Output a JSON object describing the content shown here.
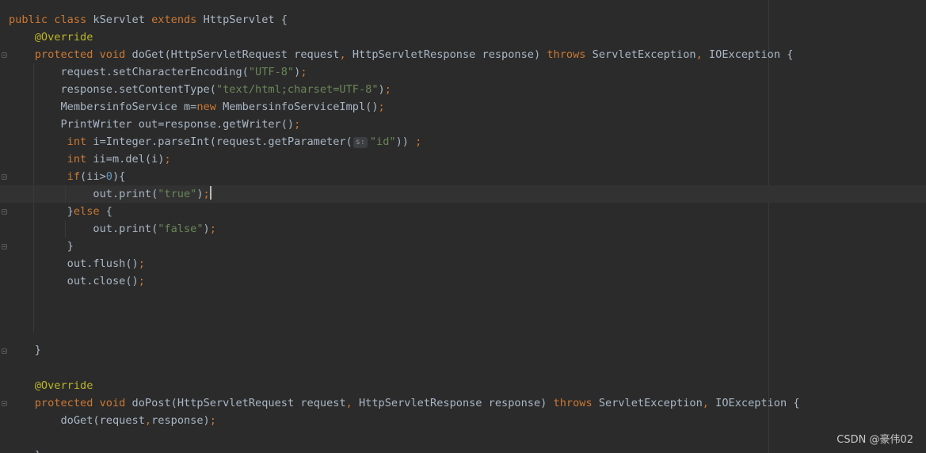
{
  "colors": {
    "background": "#2b2b2b",
    "keyword": "#cc7832",
    "annotation": "#bbb529",
    "string": "#6a8759",
    "number": "#6897bb",
    "plain": "#a9b7c6"
  },
  "code": {
    "l1": {
      "a": "public",
      "b": "class",
      "c": "kServlet",
      "d": "extends",
      "e": "HttpServlet {"
    },
    "l2": {
      "a": "@Override"
    },
    "l3": {
      "a": "protected",
      "b": "void",
      "c": "doGet(HttpServletRequest request",
      "d": ",",
      "e": " HttpServletResponse response) ",
      "f": "throws",
      "g": " ServletException",
      "h": ",",
      "i": " IOException {"
    },
    "l4": {
      "a": "request.setCharacterEncoding(",
      "b": "\"UTF-8\"",
      "c": ")",
      "d": ";"
    },
    "l5": {
      "a": "response.setContentType(",
      "b": "\"text/html;charset=UTF-8\"",
      "c": ")",
      "d": ";"
    },
    "l6": {
      "a": "MembersinfoService m=",
      "b": "new",
      "c": " MembersinfoServiceImpl()",
      "d": ";"
    },
    "l7": {
      "a": "PrintWriter out=response.getWriter()",
      "b": ";"
    },
    "l8": {
      "a": "int",
      "b": " i=Integer.parseInt(request.getParameter(",
      "hint": "s:",
      "c": "\"id\"",
      "d": ")) ",
      "e": ";"
    },
    "l9": {
      "a": "int",
      "b": " ii=m.del(i)",
      "c": ";"
    },
    "l10": {
      "a": "if",
      "b": "(ii>",
      "c": "0",
      "d": "){"
    },
    "l11": {
      "a": "out.print(",
      "b": "\"true\"",
      "c": ")",
      "d": ";"
    },
    "l12": {
      "a": "}",
      "b": "else",
      "c": " {"
    },
    "l13": {
      "a": "out.print(",
      "b": "\"false\"",
      "c": ")",
      "d": ";"
    },
    "l14": {
      "a": "}"
    },
    "l15": {
      "a": "out.flush()",
      "b": ";"
    },
    "l16": {
      "a": "out.close()",
      "b": ";"
    },
    "l17": {
      "a": "}"
    },
    "l18": {
      "a": "@Override"
    },
    "l19": {
      "a": "protected",
      "b": "void",
      "c": "doPost(HttpServletRequest request",
      "d": ",",
      "e": " HttpServletResponse response) ",
      "f": "throws",
      "g": " ServletException",
      "h": ",",
      "i": " IOException {"
    },
    "l20": {
      "a": "doGet(request",
      "b": ",",
      "c": "response)",
      "d": ";"
    },
    "l21": {
      "a": "}"
    }
  },
  "watermark": "CSDN @豪伟02"
}
